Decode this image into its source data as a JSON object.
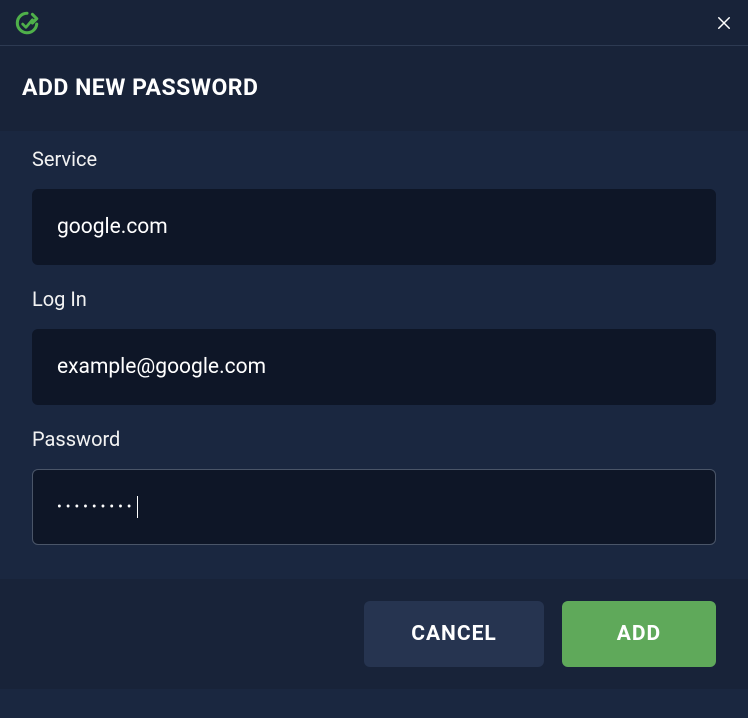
{
  "header": {
    "title": "ADD NEW PASSWORD"
  },
  "form": {
    "service": {
      "label": "Service",
      "value": "google.com"
    },
    "login": {
      "label": "Log In",
      "value": "example@google.com"
    },
    "password": {
      "label": "Password",
      "masked_value": "•••••••••"
    }
  },
  "footer": {
    "cancel_label": "CANCEL",
    "add_label": "ADD"
  },
  "colors": {
    "accent_green": "#5fa95a",
    "bg_dark": "#182339",
    "bg_main": "#1a2740",
    "input_bg": "#0e1627"
  }
}
